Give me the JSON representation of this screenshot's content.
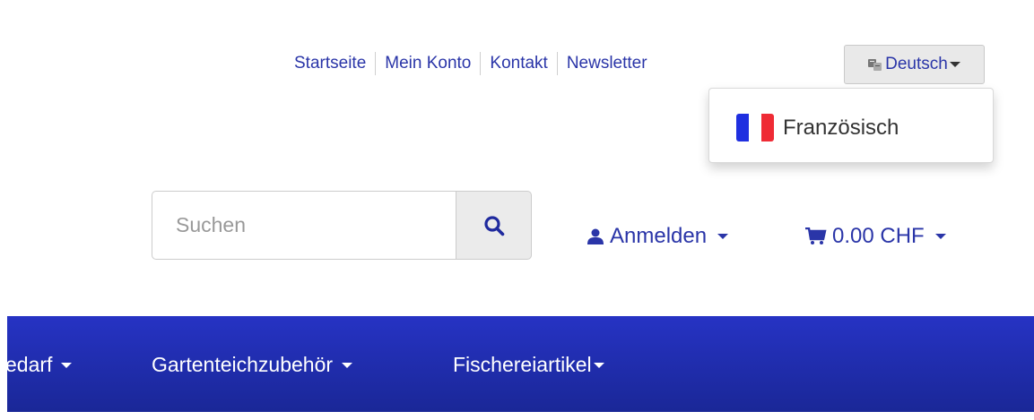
{
  "top_links": [
    {
      "label": "Startseite"
    },
    {
      "label": "Mein Konto"
    },
    {
      "label": "Kontakt"
    },
    {
      "label": "Newsletter"
    }
  ],
  "language": {
    "current": "Deutsch",
    "icon": "language-icon",
    "options": [
      {
        "label": "Französisch",
        "icon": "flag-france-icon"
      }
    ]
  },
  "search": {
    "placeholder": "Suchen",
    "value": "",
    "button_icon": "search-icon"
  },
  "account": {
    "label": "Anmelden",
    "icon": "user-icon"
  },
  "cart": {
    "total": "0.00 CHF",
    "icon": "cart-icon"
  },
  "nav": {
    "items": [
      {
        "label": "edarf"
      },
      {
        "label": "Gartenteichzubehör"
      },
      {
        "label": "Fischereiartikel"
      }
    ]
  },
  "colors": {
    "link": "#2a35a8",
    "navbar": "#1f2db0",
    "flag_blue": "#1f2fe0",
    "flag_red": "#ef2b35"
  }
}
